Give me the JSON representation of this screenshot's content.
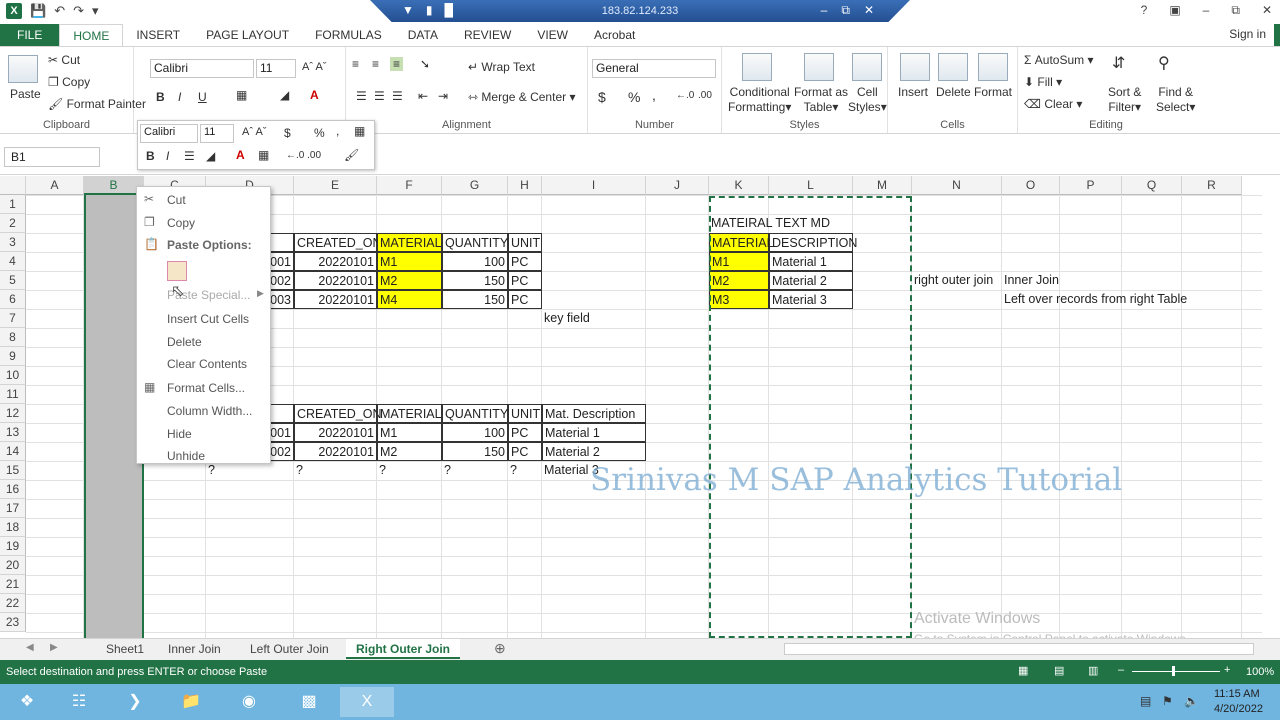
{
  "window": {
    "remote_ip": "183.82.124.233",
    "sign_in": "Sign in"
  },
  "tabs": [
    "FILE",
    "HOME",
    "INSERT",
    "PAGE LAYOUT",
    "FORMULAS",
    "DATA",
    "REVIEW",
    "VIEW",
    "Acrobat"
  ],
  "clipboard": {
    "paste": "Paste",
    "cut": "Cut",
    "copy": "Copy",
    "format_painter": "Format Painter",
    "label": "Clipboard"
  },
  "font": {
    "name": "Calibri",
    "size": "11",
    "label": "Font"
  },
  "alignment": {
    "wrap_text": "Wrap Text",
    "merge_center": "Merge & Center",
    "label": "Alignment"
  },
  "number": {
    "format": "General",
    "currency": "$",
    "percent": "%",
    "comma": ",",
    "label": "Number"
  },
  "styles": {
    "conditional": "Conditional",
    "formatting": "Formatting",
    "format_as": "Format as",
    "table": "Table",
    "cell": "Cell",
    "cell_styles": "Styles",
    "label": "Styles"
  },
  "cells": {
    "insert": "Insert",
    "delete": "Delete",
    "format": "Format",
    "label": "Cells"
  },
  "editing": {
    "autosum": "AutoSum",
    "fill": "Fill",
    "clear": "Clear",
    "sort": "Sort &",
    "filter": "Filter",
    "find": "Find &",
    "select": "Select",
    "label": "Editing"
  },
  "namebox": "B1",
  "columns": [
    "A",
    "B",
    "C",
    "D",
    "E",
    "F",
    "G",
    "H",
    "I",
    "J",
    "K",
    "L",
    "M",
    "N",
    "O",
    "P",
    "Q",
    "R"
  ],
  "rows": [
    "1",
    "2",
    "3",
    "4",
    "5",
    "6",
    "7",
    "8",
    "9",
    "10",
    "11",
    "12",
    "13",
    "14",
    "15",
    "16",
    "17",
    "18",
    "19",
    "20",
    "21",
    "22",
    "23"
  ],
  "sheet": {
    "t1_headers": [
      "BER",
      "CREATED_ON",
      "MATERIAL",
      "QUANTITY",
      "UNIT"
    ],
    "t1_rows": [
      [
        "001",
        "20220101",
        "M1",
        "100",
        "PC"
      ],
      [
        "002",
        "20220101",
        "M2",
        "150",
        "PC"
      ],
      [
        "003",
        "20220101",
        "M4",
        "150",
        "PC"
      ]
    ],
    "key_field": "key field",
    "md_title": "MATEIRAL TEXT MD",
    "md_headers": [
      "MATERIAL",
      "DESCRIPTION"
    ],
    "md_rows": [
      [
        "M1",
        "Material 1"
      ],
      [
        "M2",
        "Material 2"
      ],
      [
        "M3",
        "Material 3"
      ]
    ],
    "right_outer": "right outer join",
    "inner_join": "Inner Join",
    "left_over": "Left over records from right Table",
    "t2_headers": [
      "BER",
      "CREATED_ON",
      "MATERIAL",
      "QUANTITY",
      "UNIT",
      "Mat. Description"
    ],
    "t2_rows": [
      [
        "001",
        "20220101",
        "M1",
        "100",
        "PC",
        "Material 1"
      ],
      [
        "002",
        "20220101",
        "M2",
        "150",
        "PC",
        "Material 2"
      ]
    ],
    "t2_q": [
      "?",
      "?",
      "?",
      "?",
      "?",
      "Material 3"
    ]
  },
  "context_menu": {
    "cut": "Cut",
    "copy": "Copy",
    "paste_options": "Paste Options:",
    "paste_special": "Paste Special...",
    "insert_cut": "Insert Cut Cells",
    "delete": "Delete",
    "clear": "Clear Contents",
    "format_cells": "Format Cells...",
    "col_width": "Column Width...",
    "hide": "Hide",
    "unhide": "Unhide"
  },
  "watermark": "Srinivas M SAP Analytics Tutorial",
  "activate": {
    "title": "Activate Windows",
    "sub": "Go to System in Control Panel to activate Windows."
  },
  "sheets": [
    "Sheet1",
    "Inner Join",
    "Left Outer Join",
    "Right Outer Join"
  ],
  "status": {
    "message": "Select destination and press ENTER or choose Paste",
    "zoom": "100%"
  },
  "clock": {
    "time": "11:15 AM",
    "date": "4/20/2022"
  },
  "colors": {
    "excel_green": "#217346",
    "highlight": "#ffff00",
    "taskbar": "#6fb5e0"
  }
}
